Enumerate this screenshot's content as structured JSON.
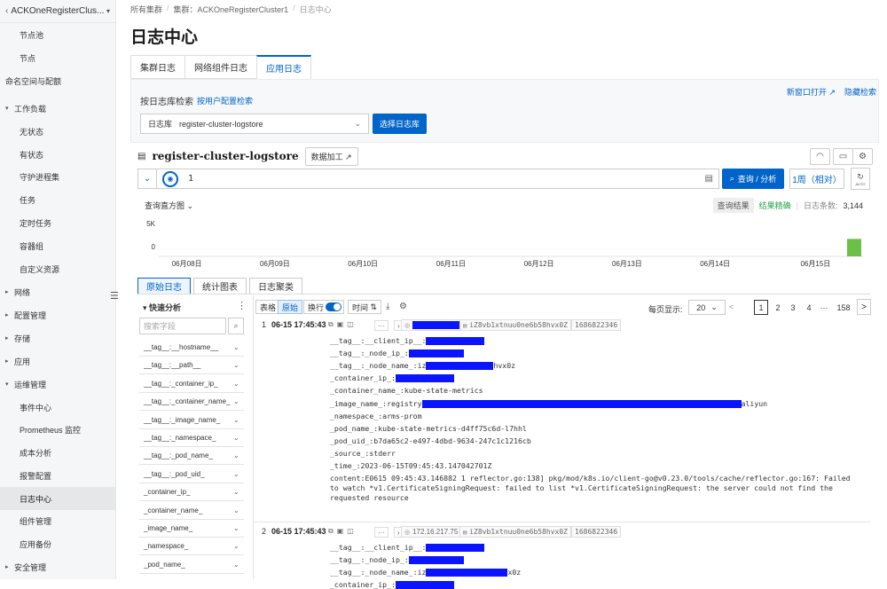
{
  "sidebar": {
    "cluster": "ACKOneRegisterClus...",
    "items": [
      {
        "label": "节点池",
        "level": "child"
      },
      {
        "label": "节点",
        "level": "child"
      },
      {
        "label": "命名空间与配额",
        "level": "root"
      },
      {
        "label": "工作负载",
        "level": "group",
        "expanded": true
      },
      {
        "label": "无状态",
        "level": "child"
      },
      {
        "label": "有状态",
        "level": "child"
      },
      {
        "label": "守护进程集",
        "level": "child"
      },
      {
        "label": "任务",
        "level": "child"
      },
      {
        "label": "定时任务",
        "level": "child"
      },
      {
        "label": "容器组",
        "level": "child"
      },
      {
        "label": "自定义资源",
        "level": "child"
      },
      {
        "label": "网络",
        "level": "group",
        "expanded": false
      },
      {
        "label": "配置管理",
        "level": "group",
        "expanded": false
      },
      {
        "label": "存储",
        "level": "group",
        "expanded": false
      },
      {
        "label": "应用",
        "level": "group",
        "expanded": false
      },
      {
        "label": "运维管理",
        "level": "group",
        "expanded": true
      },
      {
        "label": "事件中心",
        "level": "child"
      },
      {
        "label": "Prometheus 监控",
        "level": "child"
      },
      {
        "label": "成本分析",
        "level": "child"
      },
      {
        "label": "报警配置",
        "level": "child"
      },
      {
        "label": "日志中心",
        "level": "child",
        "active": true
      },
      {
        "label": "组件管理",
        "level": "child"
      },
      {
        "label": "应用备份",
        "level": "child"
      },
      {
        "label": "安全管理",
        "level": "group",
        "expanded": false
      }
    ]
  },
  "breadcrumb": [
    "所有集群",
    "集群：ACKOneRegisterCluster1",
    "日志中心"
  ],
  "page_title": "日志中心",
  "tabs": [
    "集群日志",
    "网络组件日志",
    "应用日志"
  ],
  "search": {
    "label": "按日志库检索",
    "alt_link": "按用户配置检索",
    "select_key": "日志库",
    "select_value": "register-cluster-logstore",
    "button": "选择日志库",
    "links": [
      "新窗口打开",
      "隐藏检索"
    ]
  },
  "logstore": {
    "name": "register-cluster-logstore",
    "data_process": "数据加工"
  },
  "query": {
    "text": "1",
    "button": "查询 / 分析",
    "time_range": "1周（相对）",
    "auto_label": "AUTO"
  },
  "histogram": {
    "title": "查询直方图",
    "result_label": "查询结果",
    "exact_label": "结果精确",
    "count_label": "日志条数:",
    "count": "3,144",
    "accent": "#6cc04a"
  },
  "chart_data": {
    "type": "bar",
    "title": "查询直方图",
    "xlabel": "",
    "ylabel": "",
    "categories": [
      "06月08日",
      "06月09日",
      "06月10日",
      "06月11日",
      "06月12日",
      "06月13日",
      "06月14日",
      "06月15日"
    ],
    "values": [
      0,
      0,
      0,
      0,
      0,
      0,
      0,
      3144
    ],
    "yticks": [
      "5K",
      "0"
    ],
    "ylim": [
      0,
      5000
    ],
    "grid": false
  },
  "log_tabs": [
    "原始日志",
    "统计图表",
    "日志聚类"
  ],
  "quick_analysis": {
    "title": "快速分析",
    "search_placeholder": "搜索字段",
    "fields": [
      "__tag__:__hostname__",
      "__tag__:__path__",
      "__tag__:_container_ip_",
      "__tag__:_container_name_",
      "__tag__:_image_name_",
      "__tag__:_namespace_",
      "__tag__:_pod_name_",
      "__tag__:_pod_uid_",
      "_container_ip_",
      "_container_name_",
      "_image_name_",
      "_namespace_",
      "_pod_name_"
    ]
  },
  "toolbar": {
    "table": "表格",
    "raw": "原始",
    "wrap": "换行",
    "time": "时间",
    "per_page_label": "每页显示:",
    "per_page": "20",
    "pages": [
      "1",
      "2",
      "3",
      "4",
      "···",
      "158"
    ]
  },
  "records": [
    {
      "no": "1",
      "time": "06-15 17:45:43",
      "ip": "",
      "host": "iZ8vb1xtnuu0ne6b58hvx0Z",
      "ts": "1686822346",
      "fields": [
        {
          "k": "__tag__:__client_ip__:",
          "pre": "",
          "post": ""
        },
        {
          "k": "__tag__:_node_ip_:",
          "pre": "",
          "post": ""
        },
        {
          "k": "__tag__:_node_name_:",
          "pre": "iz",
          "post": "hvx0z"
        },
        {
          "k": "_container_ip_:",
          "pre": "",
          "post": ""
        },
        {
          "k": "_container_name_:",
          "pre": "kube-state-metrics",
          "post": ""
        },
        {
          "k": "_image_name_:",
          "pre": "registry",
          "post": "aliyun"
        },
        {
          "k": "_namespace_:",
          "pre": "arms-prom",
          "post": ""
        },
        {
          "k": "_pod_name_:",
          "pre": "kube-state-metrics-d4ff75c6d-l7hhl",
          "post": ""
        },
        {
          "k": "_pod_uid_:",
          "pre": "b7da65c2-e497-4dbd-9634-247c1c1216cb",
          "post": ""
        },
        {
          "k": "_source_:",
          "pre": "stderr",
          "post": ""
        },
        {
          "k": "_time_:",
          "pre": "2023-06-15T09:45:43.147042701Z",
          "post": ""
        }
      ],
      "content_key": "content:",
      "content": "E0615 09:45:43.146882       1 reflector.go:138] pkg/mod/k8s.io/client-go@v0.23.0/tools/cache/reflector.go:167: Failed to watch *v1.CertificateSigningRequest: failed to list *v1.CertificateSigningRequest: the server could not find the requested resource"
    },
    {
      "no": "2",
      "time": "06-15 17:45:43",
      "ip": "172.16.217.75",
      "host": "iZ8vb1xtnuu0ne6b58hvx0Z",
      "ts": "1686822346",
      "fields": [
        {
          "k": "__tag__:__client_ip__:",
          "pre": "",
          "post": ""
        },
        {
          "k": "__tag__:_node_ip_:",
          "pre": "",
          "post": ""
        },
        {
          "k": "__tag__:_node_name_:",
          "pre": "iz",
          "post": "x0z"
        },
        {
          "k": "_container_ip_:",
          "pre": "",
          "post": ""
        }
      ]
    }
  ]
}
